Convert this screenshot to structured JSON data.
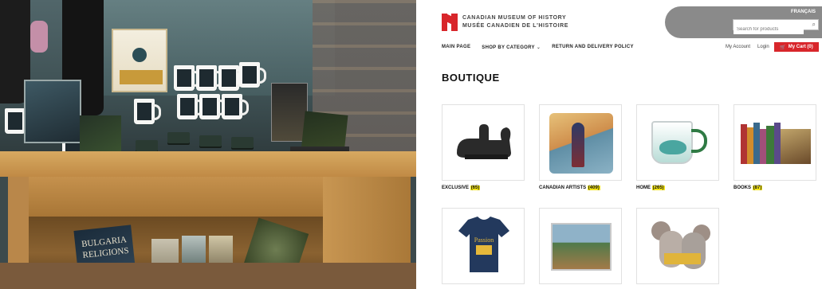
{
  "site": {
    "logo_line1": "CANADIAN MUSEUM OF HISTORY",
    "logo_line2": "MUSÉE CANADIEN DE L'HISTOIRE",
    "language_link": "FRANÇAIS",
    "search_placeholder": "Search for products",
    "nav": [
      "MAIN PAGE",
      "SHOP BY CATEGORY",
      "RETURN AND DELIVERY POLICY"
    ],
    "account": "My Account",
    "login": "Login",
    "cart_label": "My Cart (0)",
    "page_title": "BOUTIQUE",
    "categories": [
      {
        "name": "EXCLUSIVE",
        "count": "(65)"
      },
      {
        "name": "CANADIAN ARTISTS",
        "count": "(409)"
      },
      {
        "name": "HOME",
        "count": "(265)"
      },
      {
        "name": "BOOKS",
        "count": "(87)"
      }
    ],
    "accent_red": "#d8262b",
    "highlight_yellow": "#f5e61a"
  },
  "photo": {
    "book_title_1": "BULGARIA",
    "book_title_2": "RELIGIONS"
  }
}
